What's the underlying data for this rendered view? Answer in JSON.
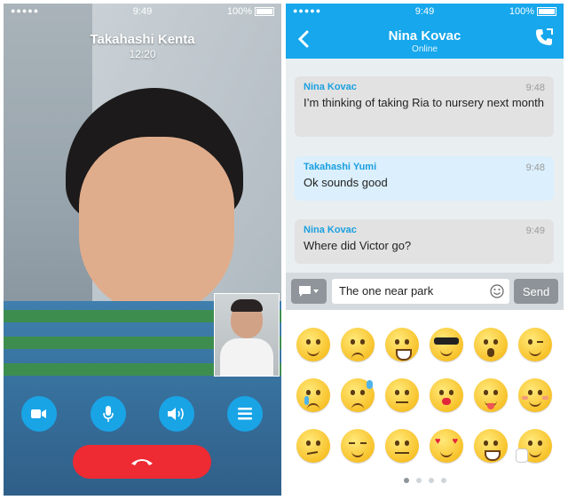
{
  "call": {
    "status": {
      "dots": "●●●●●",
      "time": "9:49",
      "battery": "100%"
    },
    "caller_name": "Takahashi Kenta",
    "duration": "12:20",
    "controls": [
      "video-icon",
      "mic-icon",
      "speaker-icon",
      "menu-icon",
      "hangup-icon"
    ]
  },
  "chat": {
    "status": {
      "dots": "●●●●●",
      "time": "9:49",
      "battery": "100%"
    },
    "title": "Nina Kovac",
    "presence": "Online",
    "messages": [
      {
        "author": "Nina Kovac",
        "time": "9:48",
        "text": "I’m thinking of taking Ria to nursery next month"
      },
      {
        "author": "Takahashi Yumi",
        "time": "9:48",
        "text": "Ok sounds good"
      },
      {
        "author": "Nina Kovac",
        "time": "9:49",
        "text": "Where did Victor go?"
      }
    ],
    "input_value": "The one near park",
    "send_label": "Send",
    "emoticon_page": {
      "current": 1,
      "total": 4
    }
  },
  "colors": {
    "accent": "#16a7ec",
    "end_call": "#ee2a32"
  }
}
